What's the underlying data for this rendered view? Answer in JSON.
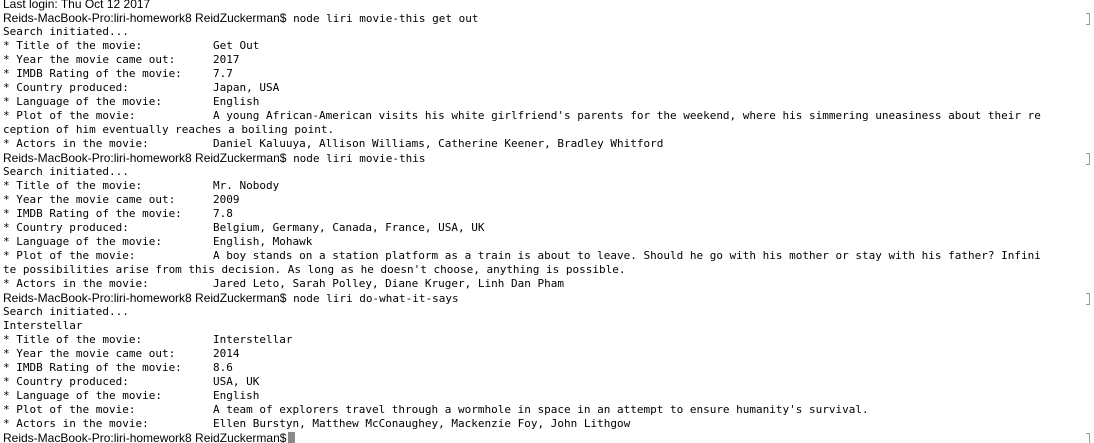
{
  "terminal": {
    "top_partial": "Last login: Thu Oct 12 2017",
    "sessions": [
      {
        "prompt": "Reids-MacBook-Pro:liri-homework8 ReidZuckerman$",
        "command": "node liri movie-this get out",
        "status": "Search initiated...",
        "extra": "",
        "fields": [
          {
            "label": "* Title of the movie:",
            "value": "Get Out"
          },
          {
            "label": "* Year the movie came out:",
            "value": "2017"
          },
          {
            "label": "* IMDB Rating of the movie:",
            "value": "7.7"
          },
          {
            "label": "* Country produced:",
            "value": "Japan, USA"
          },
          {
            "label": "* Language of the movie:",
            "value": "English"
          },
          {
            "label": "* Plot of the movie:",
            "value": "A young African-American visits his white girlfriend's parents for the weekend, where his simmering uneasiness about their re",
            "wrap": "ception of him eventually reaches a boiling point."
          },
          {
            "label": "* Actors in the movie:",
            "value": "Daniel Kaluuya, Allison Williams, Catherine Keener, Bradley Whitford"
          }
        ]
      },
      {
        "prompt": "Reids-MacBook-Pro:liri-homework8 ReidZuckerman$",
        "command": "node liri movie-this",
        "status": "Search initiated...",
        "extra": "",
        "fields": [
          {
            "label": "* Title of the movie:",
            "value": "Mr. Nobody"
          },
          {
            "label": "* Year the movie came out:",
            "value": "2009"
          },
          {
            "label": "* IMDB Rating of the movie:",
            "value": "7.8"
          },
          {
            "label": "* Country produced:",
            "value": "Belgium, Germany, Canada, France, USA, UK"
          },
          {
            "label": "* Language of the movie:",
            "value": "English, Mohawk"
          },
          {
            "label": "* Plot of the movie:",
            "value": "A boy stands on a station platform as a train is about to leave. Should he go with his mother or stay with his father? Infini",
            "wrap": "te possibilities arise from this decision. As long as he doesn't choose, anything is possible."
          },
          {
            "label": "* Actors in the movie:",
            "value": "Jared Leto, Sarah Polley, Diane Kruger, Linh Dan Pham"
          }
        ]
      },
      {
        "prompt": "Reids-MacBook-Pro:liri-homework8 ReidZuckerman$",
        "command": "node liri do-what-it-says",
        "status": "Search initiated...",
        "extra": "Interstellar",
        "fields": [
          {
            "label": "* Title of the movie:",
            "value": "Interstellar"
          },
          {
            "label": "* Year the movie came out:",
            "value": "2014"
          },
          {
            "label": "* IMDB Rating of the movie:",
            "value": "8.6"
          },
          {
            "label": "* Country produced:",
            "value": "USA, UK"
          },
          {
            "label": "* Language of the movie:",
            "value": "English"
          },
          {
            "label": "* Plot of the movie:",
            "value": "A team of explorers travel through a wormhole in space in an attempt to ensure humanity's survival."
          },
          {
            "label": "* Actors in the movie:",
            "value": "Ellen Burstyn, Matthew McConaughey, Mackenzie Foy, John Lithgow"
          }
        ]
      }
    ],
    "final_prompt": "Reids-MacBook-Pro:liri-homework8 ReidZuckerman$"
  }
}
